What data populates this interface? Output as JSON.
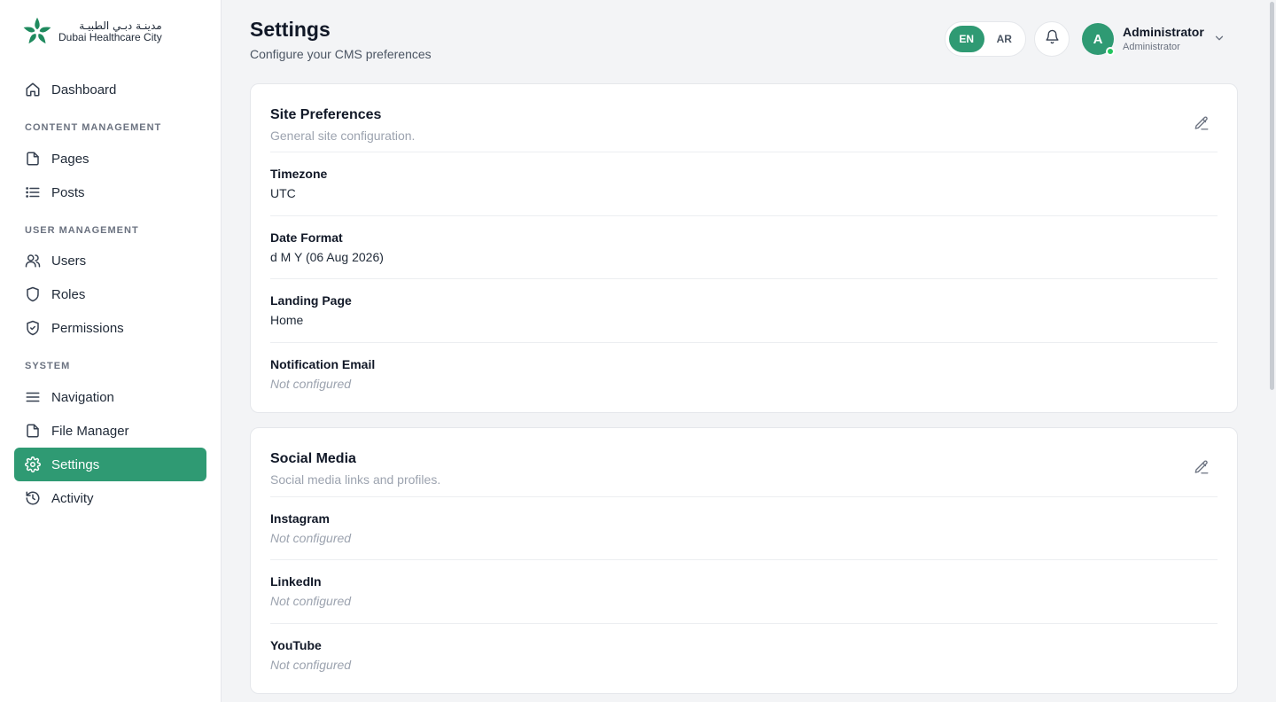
{
  "brand": {
    "name_ar": "مدينـة دبـي الطبيـة",
    "name_en": "Dubai Healthcare City",
    "color": "#1f8a5e"
  },
  "sidebar": {
    "dashboard": {
      "label": "Dashboard",
      "icon": "home-icon"
    },
    "sections": {
      "content": "CONTENT MANAGEMENT",
      "user": "USER MANAGEMENT",
      "system": "SYSTEM"
    },
    "items": {
      "pages": {
        "label": "Pages",
        "icon": "file-icon"
      },
      "posts": {
        "label": "Posts",
        "icon": "list-icon"
      },
      "users": {
        "label": "Users",
        "icon": "users-icon"
      },
      "roles": {
        "label": "Roles",
        "icon": "shield-icon"
      },
      "permissions": {
        "label": "Permissions",
        "icon": "shield-check-icon"
      },
      "navigation": {
        "label": "Navigation",
        "icon": "menu-icon"
      },
      "file_manager": {
        "label": "File Manager",
        "icon": "file-icon"
      },
      "settings": {
        "label": "Settings",
        "icon": "gear-icon",
        "active": true
      },
      "activity": {
        "label": "Activity",
        "icon": "history-icon"
      }
    },
    "active_color": "#2f9a73"
  },
  "header": {
    "title": "Settings",
    "subtitle": "Configure your CMS preferences",
    "lang": {
      "en": "EN",
      "ar": "AR",
      "selected": "EN"
    },
    "user": {
      "initial": "A",
      "name": "Administrator",
      "role": "Administrator"
    }
  },
  "cards": {
    "site": {
      "title": "Site Preferences",
      "description": "General site configuration.",
      "fields": {
        "timezone": {
          "label": "Timezone",
          "value": "UTC"
        },
        "date_format": {
          "label": "Date Format",
          "value": "d M Y (06 Aug 2026)"
        },
        "landing_page": {
          "label": "Landing Page",
          "value": "Home"
        },
        "notification_email": {
          "label": "Notification Email",
          "value": "Not configured"
        }
      }
    },
    "social": {
      "title": "Social Media",
      "description": "Social media links and profiles.",
      "fields": {
        "instagram": {
          "label": "Instagram",
          "value": "Not configured"
        },
        "linkedin": {
          "label": "LinkedIn",
          "value": "Not configured"
        },
        "youtube": {
          "label": "YouTube",
          "value": "Not configured"
        }
      }
    }
  }
}
